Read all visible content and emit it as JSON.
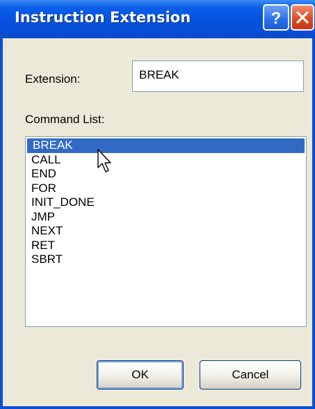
{
  "window": {
    "title": "Instruction Extension"
  },
  "titlebar_buttons": {
    "help_icon": "question-mark",
    "close_icon": "x"
  },
  "extension": {
    "label": "Extension:",
    "value": "BREAK"
  },
  "command_list": {
    "label": "Command List:",
    "items": [
      "BREAK",
      "CALL",
      "END",
      "FOR",
      "INIT_DONE",
      "JMP",
      "NEXT",
      "RET",
      "SBRT"
    ],
    "selected_index": 0
  },
  "buttons": {
    "ok_label": "OK",
    "cancel_label": "Cancel"
  },
  "colors": {
    "titlebar": "#0A4FD8",
    "selection": "#316AC5",
    "dialog_bg": "#ECE9D8"
  }
}
